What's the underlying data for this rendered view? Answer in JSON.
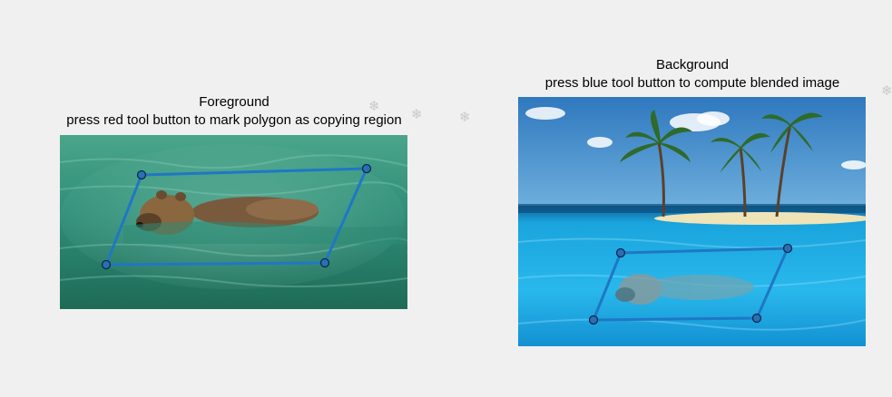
{
  "foreground": {
    "title": "Foreground",
    "instruction": "press red tool button to mark polygon as copying region"
  },
  "background": {
    "title": "Background",
    "instruction": "press blue tool button to compute blended image"
  },
  "colors": {
    "polygon_line": "#1f77c4",
    "vertex_fill": "#2a6fb5",
    "water_fg": "#2f8f7a",
    "water_bg": "#1fb4e8",
    "sky_bg": "#3a86c8",
    "sand": "#efe3b8",
    "window_bg": "#f0f0f0"
  },
  "icons": {
    "decorative_marks": "snowflake-icon"
  }
}
